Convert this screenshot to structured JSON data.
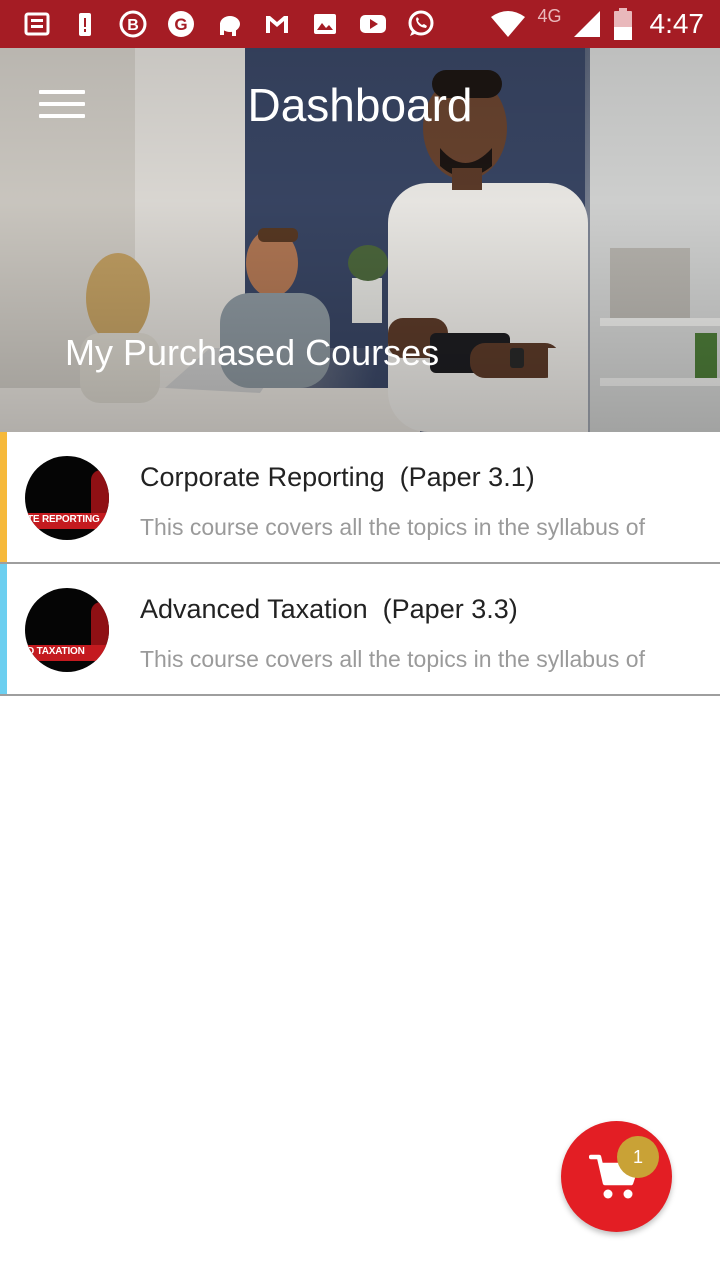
{
  "status_bar": {
    "network_label": "4G",
    "time": "4:47",
    "icons": [
      "news-icon",
      "battery-alert-icon",
      "b-app-icon",
      "g-app-icon",
      "elephant-app-icon",
      "gmail-icon",
      "image-icon",
      "youtube-icon",
      "whatsapp-icon",
      "wifi-icon",
      "cell-signal-icon",
      "battery-icon"
    ]
  },
  "header": {
    "title": "Dashboard",
    "subtitle": "My Purchased Courses",
    "menu_icon": "hamburger-icon"
  },
  "courses": [
    {
      "title": "Corporate Reporting  (Paper 3.1)",
      "description": "This course covers all the topics in the syllabus of",
      "thumb_text": "TE REPORTING",
      "accent_color": "#f6b93b"
    },
    {
      "title": "Advanced Taxation  (Paper 3.3)",
      "description": "This course covers all the topics in the syllabus of",
      "thumb_text": "D TAXATION",
      "accent_color": "#6ccff0"
    }
  ],
  "cart": {
    "badge_count": "1",
    "icon": "cart-icon",
    "color": "#e31e24",
    "badge_color": "#c9a236"
  },
  "colors": {
    "status_bar": "#a51c24"
  }
}
